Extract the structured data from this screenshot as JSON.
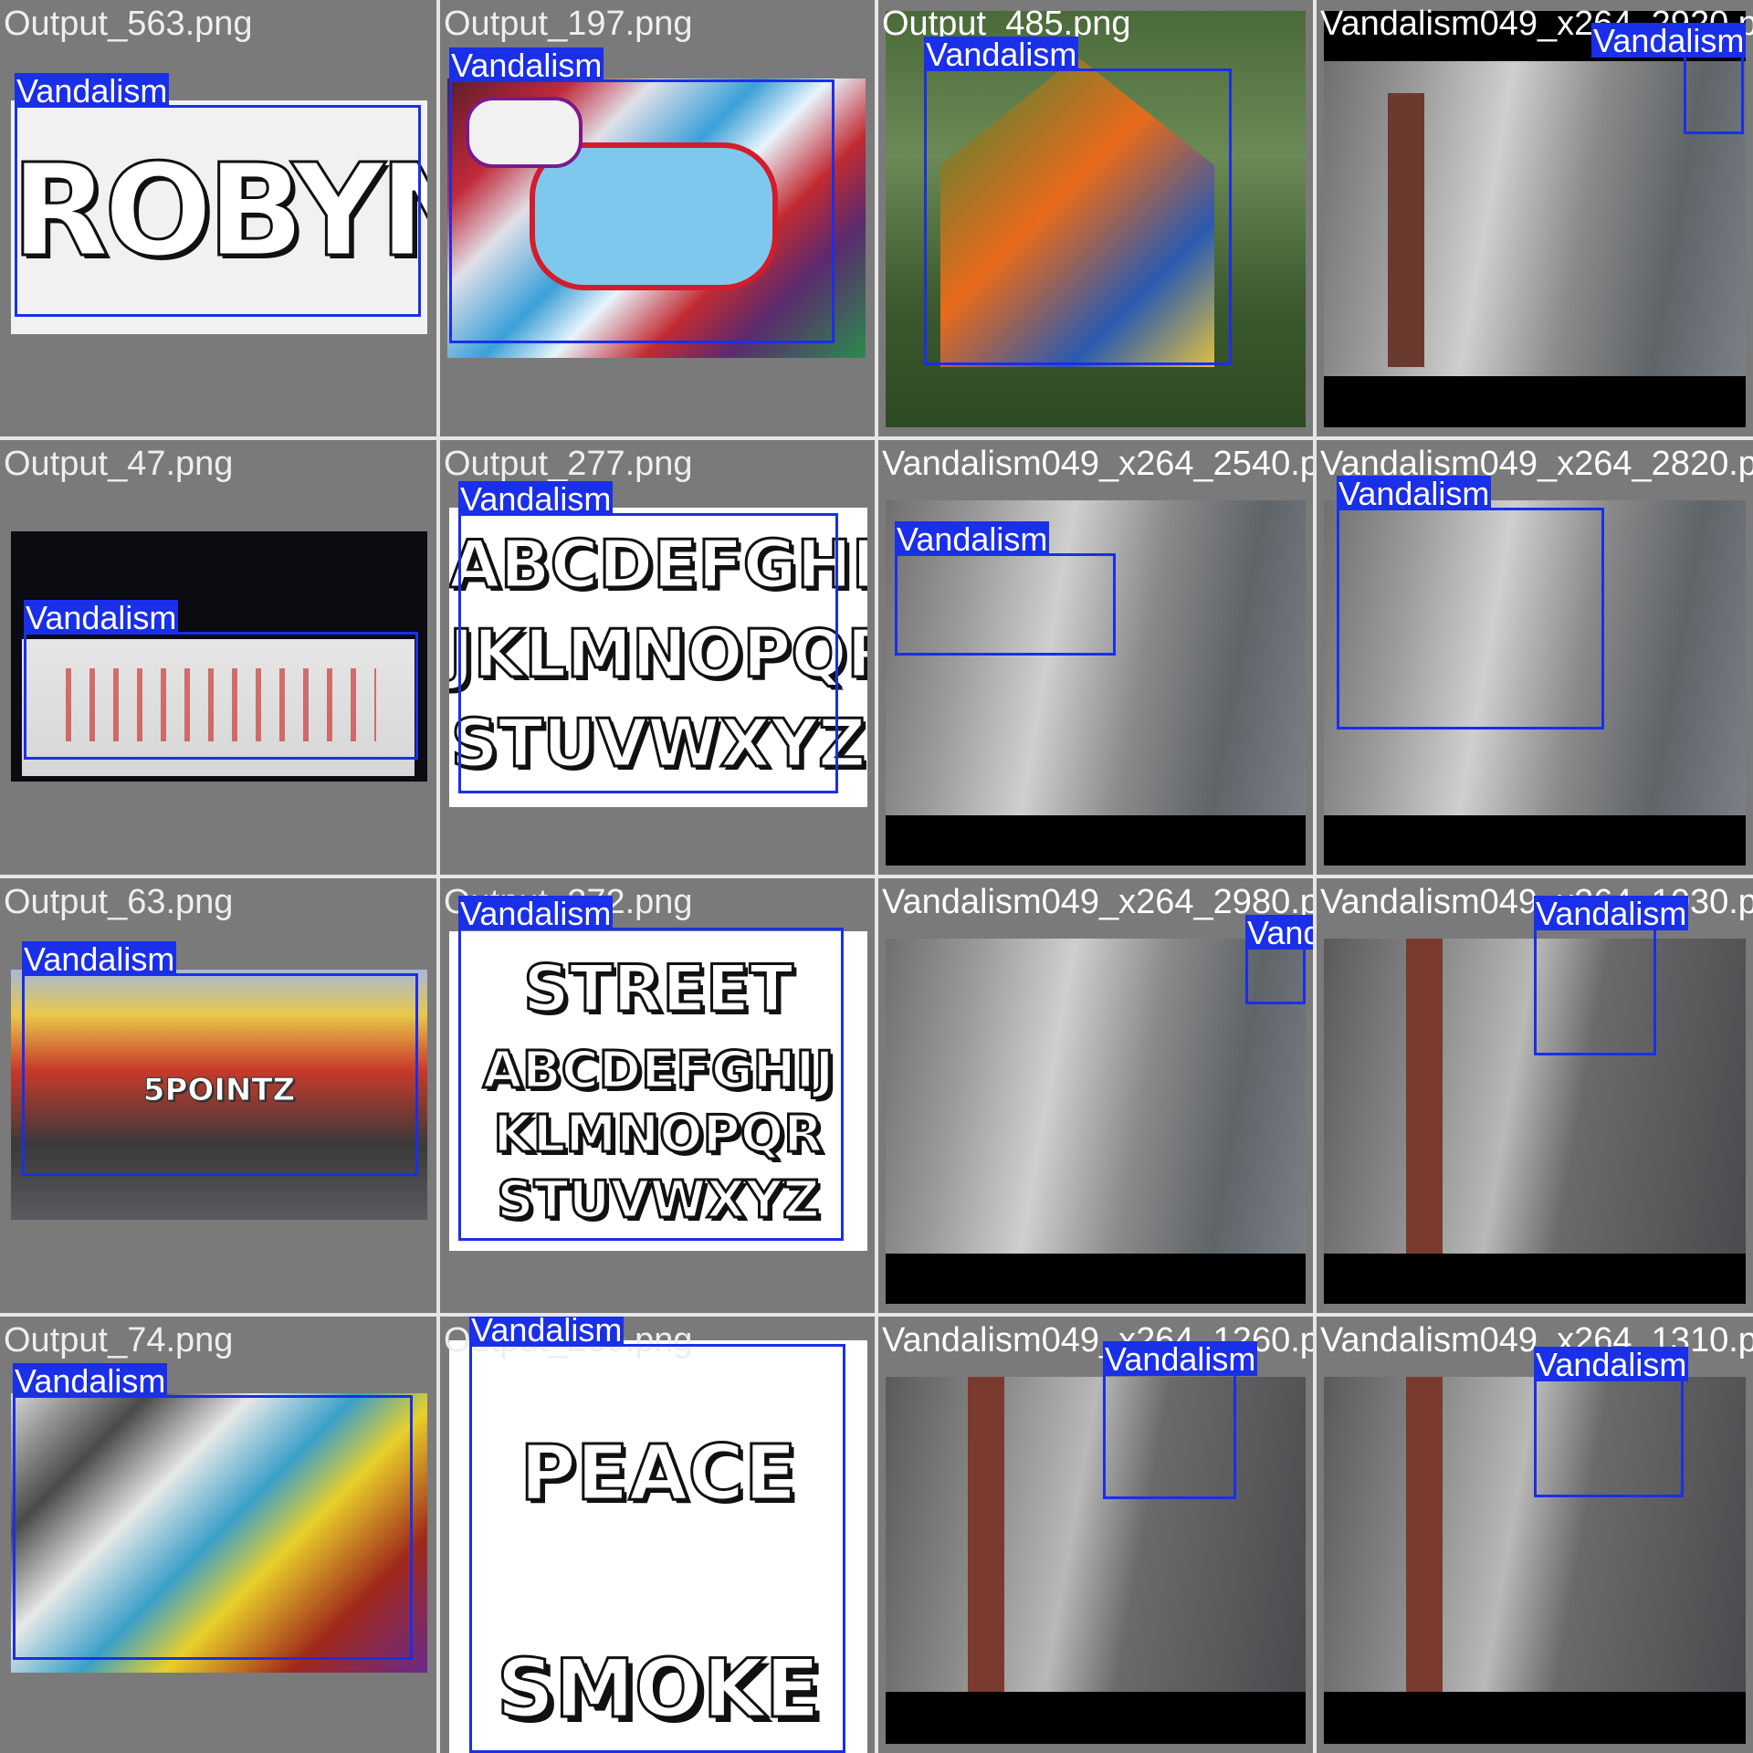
{
  "label": "Vandalism",
  "colors": {
    "box": "#1a2fe8",
    "cell_bg": "#7a7a7a",
    "grid_gap": "#e6e6e6"
  },
  "cells": [
    {
      "filename": "Output_563.png",
      "scene": "paper-bubble",
      "artwork_text": "ROBYN"
    },
    {
      "filename": "Output_197.png",
      "scene": "colorful-graffiti"
    },
    {
      "filename": "Output_485.png",
      "scene": "painted-house"
    },
    {
      "filename": "Vandalism049_x264_2920.png",
      "scene": "cctv-corridor"
    },
    {
      "filename": "Output_47.png",
      "scene": "night-wall"
    },
    {
      "filename": "Output_277.png",
      "scene": "paper-alphabet",
      "artwork_lines": [
        "ABCDEFGHI",
        "JKLMNOPQR",
        "STUVWXYZ"
      ]
    },
    {
      "filename": "Vandalism049_x264_2540.png",
      "scene": "cctv-corridor"
    },
    {
      "filename": "Vandalism049_x264_2820.png",
      "scene": "cctv-corridor"
    },
    {
      "filename": "Output_63.png",
      "scene": "building-5pointz",
      "artwork_text": "5POINTZ"
    },
    {
      "filename": "Output_272.png",
      "scene": "paper-street",
      "artwork_lines": [
        "STREET",
        "ABCDEFGHIJ",
        "KLMNOPQR",
        "STUVWXYZ"
      ]
    },
    {
      "filename": "Vandalism049_x264_2980.png",
      "scene": "cctv-corridor"
    },
    {
      "filename": "Vandalism049_x264_1030.png",
      "scene": "cctv-corridor-2"
    },
    {
      "filename": "Output_74.png",
      "scene": "graffiti-building"
    },
    {
      "filename": "Output_260.png",
      "scene": "paper-peace",
      "artwork_lines": [
        "PEACE",
        "SMOKE"
      ]
    },
    {
      "filename": "Vandalism049_x264_1260.png",
      "scene": "cctv-corridor-2"
    },
    {
      "filename": "Vandalism049_x264_1310.png",
      "scene": "cctv-corridor-2"
    }
  ]
}
